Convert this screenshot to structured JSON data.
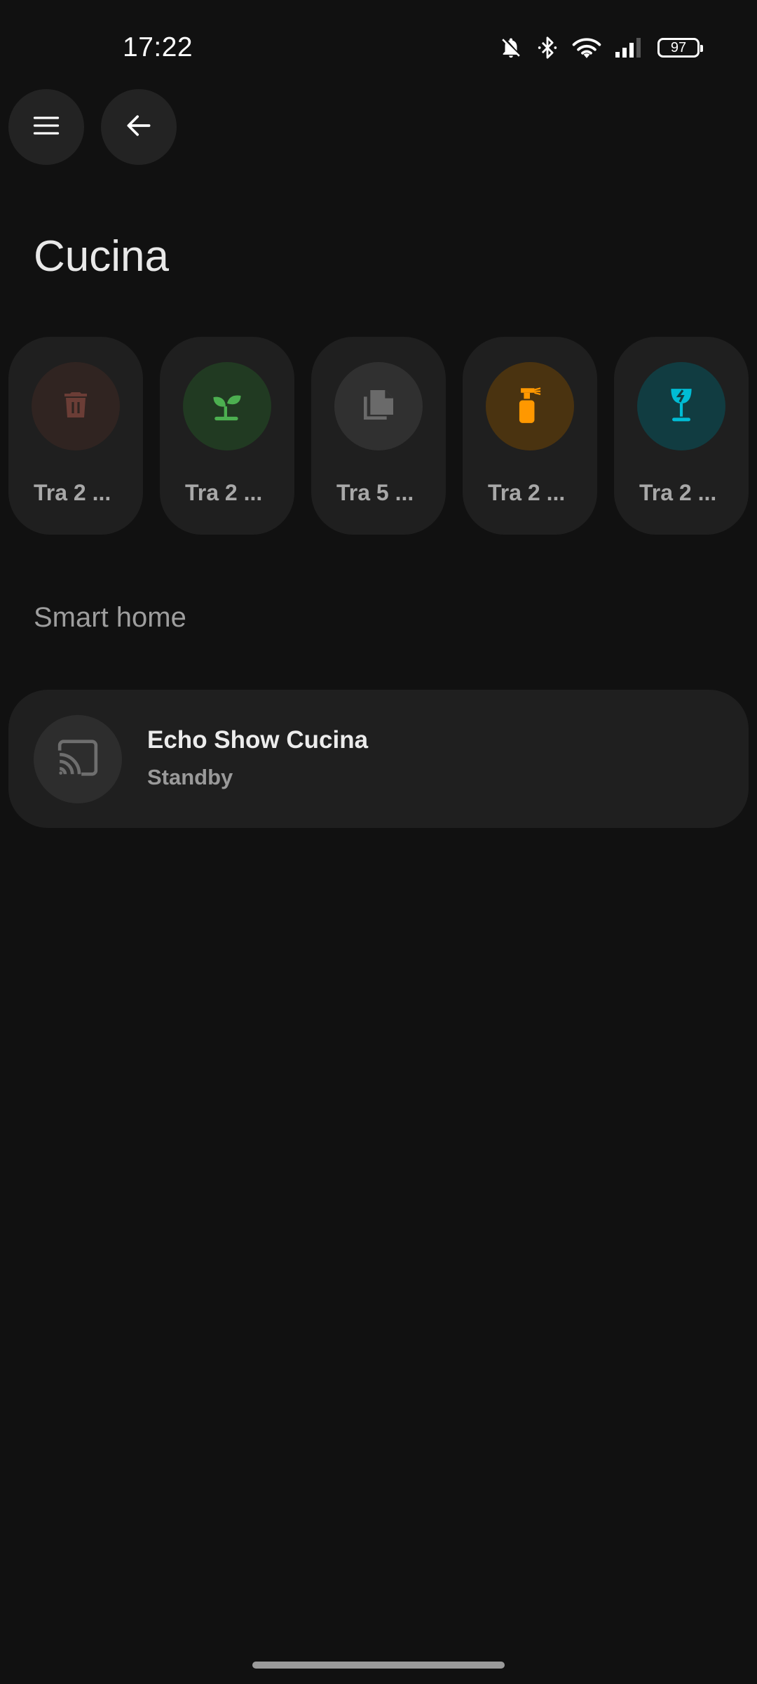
{
  "status_bar": {
    "time": "17:22",
    "battery_level": "97",
    "icons": [
      "bell-off-icon",
      "bluetooth-icon",
      "wifi-icon",
      "cell-signal-icon",
      "battery-icon"
    ]
  },
  "header": {
    "menu_icon": "menu-icon",
    "back_icon": "arrow-left-icon"
  },
  "page": {
    "title": "Cucina"
  },
  "chips": [
    {
      "label": "Tra 2 ...",
      "icon": "trash-icon",
      "icon_color": "#6b3d36",
      "bg_color": "#302421"
    },
    {
      "label": "Tra 2 ...",
      "icon": "sprout-icon",
      "icon_color": "#4caf50",
      "bg_color": "#213a22"
    },
    {
      "label": "Tra 5 ...",
      "icon": "documents-icon",
      "icon_color": "#6a6a6a",
      "bg_color": "#303030"
    },
    {
      "label": "Tra 2 ...",
      "icon": "spray-bottle-icon",
      "icon_color": "#ff9800",
      "bg_color": "#4a3310"
    },
    {
      "label": "Tra 2 ...",
      "icon": "glass-broken-icon",
      "icon_color": "#00bcd4",
      "bg_color": "#113c41"
    }
  ],
  "smart_home": {
    "section_title": "Smart home",
    "device": {
      "name": "Echo Show Cucina",
      "status": "Standby",
      "icon": "cast-icon"
    }
  }
}
